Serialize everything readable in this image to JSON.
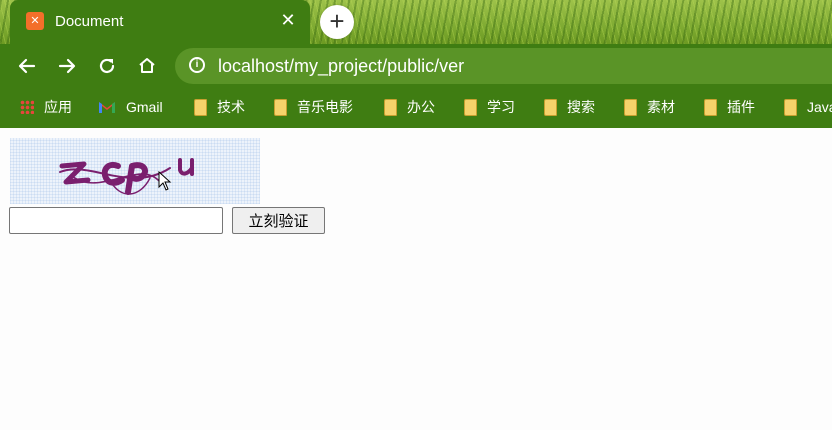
{
  "tab": {
    "title": "Document",
    "favicon": "xampp-icon",
    "close_label": "✕",
    "new_tab_label": "+"
  },
  "toolbar": {
    "back_icon": "arrow-left-icon",
    "forward_icon": "arrow-right-icon",
    "reload_icon": "reload-icon",
    "home_icon": "home-icon",
    "url": "localhost/my_project/public/ver"
  },
  "bookmarks": {
    "items": [
      {
        "label": "应用",
        "icon": "apps-icon"
      },
      {
        "label": "Gmail",
        "icon": "gmail-icon"
      },
      {
        "label": "技术",
        "icon": "folder-icon"
      },
      {
        "label": "音乐电影",
        "icon": "folder-icon"
      },
      {
        "label": "办公",
        "icon": "folder-icon"
      },
      {
        "label": "学习",
        "icon": "folder-icon"
      },
      {
        "label": "搜索",
        "icon": "folder-icon"
      },
      {
        "label": "素材",
        "icon": "folder-icon"
      },
      {
        "label": "插件",
        "icon": "folder-icon"
      },
      {
        "label": "Java",
        "icon": "folder-icon"
      }
    ]
  },
  "page": {
    "captcha_text": "zcpu",
    "code_input_value": "",
    "verify_button_label": "立刻验证"
  },
  "colors": {
    "chrome_green": "#3f7d12",
    "omnibox_green": "#5a9427",
    "captcha_ink": "#7a1f6e"
  }
}
